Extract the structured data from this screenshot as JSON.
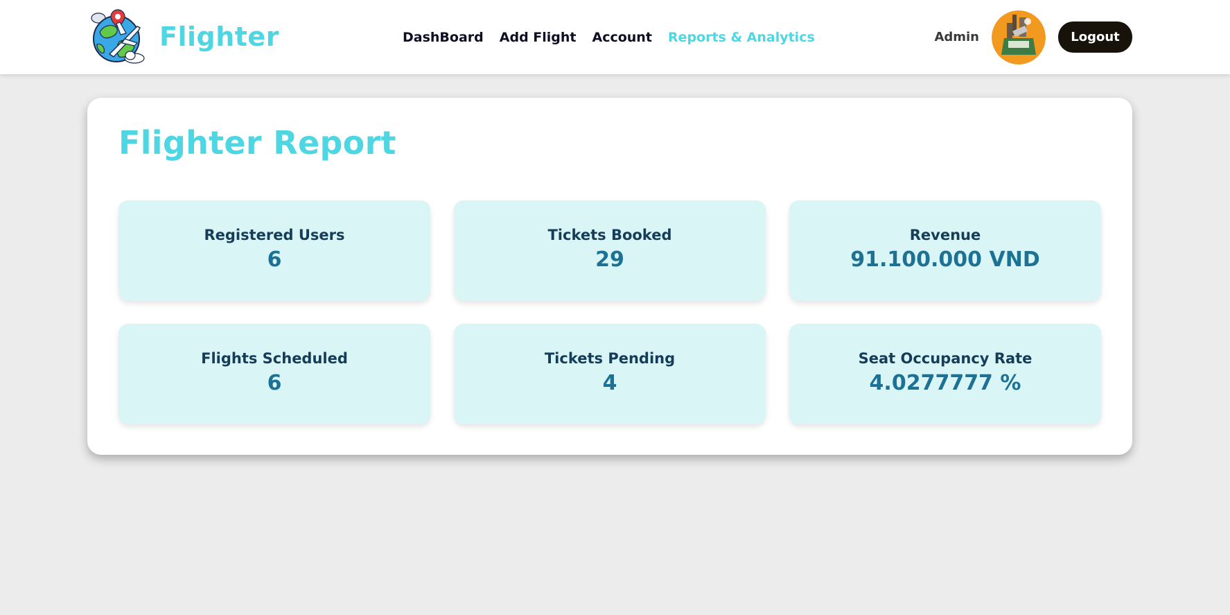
{
  "brand": {
    "name": "Flighter",
    "logo_icon": "globe-airplane-logo-icon"
  },
  "nav": {
    "items": [
      {
        "label": "DashBoard",
        "active": false
      },
      {
        "label": "Add Flight",
        "active": false
      },
      {
        "label": "Account",
        "active": false
      },
      {
        "label": "Reports & Analytics",
        "active": true
      }
    ],
    "active_color": "#4fd6e3"
  },
  "user": {
    "role_label": "Admin",
    "avatar_icon": "user-avatar-icon",
    "logout_label": "Logout"
  },
  "report": {
    "title": "Flighter Report",
    "stats": [
      {
        "label": "Registered Users",
        "value": "6"
      },
      {
        "label": "Tickets Booked",
        "value": "29"
      },
      {
        "label": "Revenue",
        "value": "91.100.000 VND"
      },
      {
        "label": "Flights Scheduled",
        "value": "6"
      },
      {
        "label": "Tickets Pending",
        "value": "4"
      },
      {
        "label": "Seat Occupancy Rate",
        "value": "4.0277777 %"
      }
    ]
  },
  "colors": {
    "accent": "#4fd6e3",
    "stat_background": "#d9f5f5",
    "stat_label": "#153d5a",
    "stat_value": "#1d7194",
    "logout_background": "#17130a",
    "page_background": "#ececec"
  }
}
